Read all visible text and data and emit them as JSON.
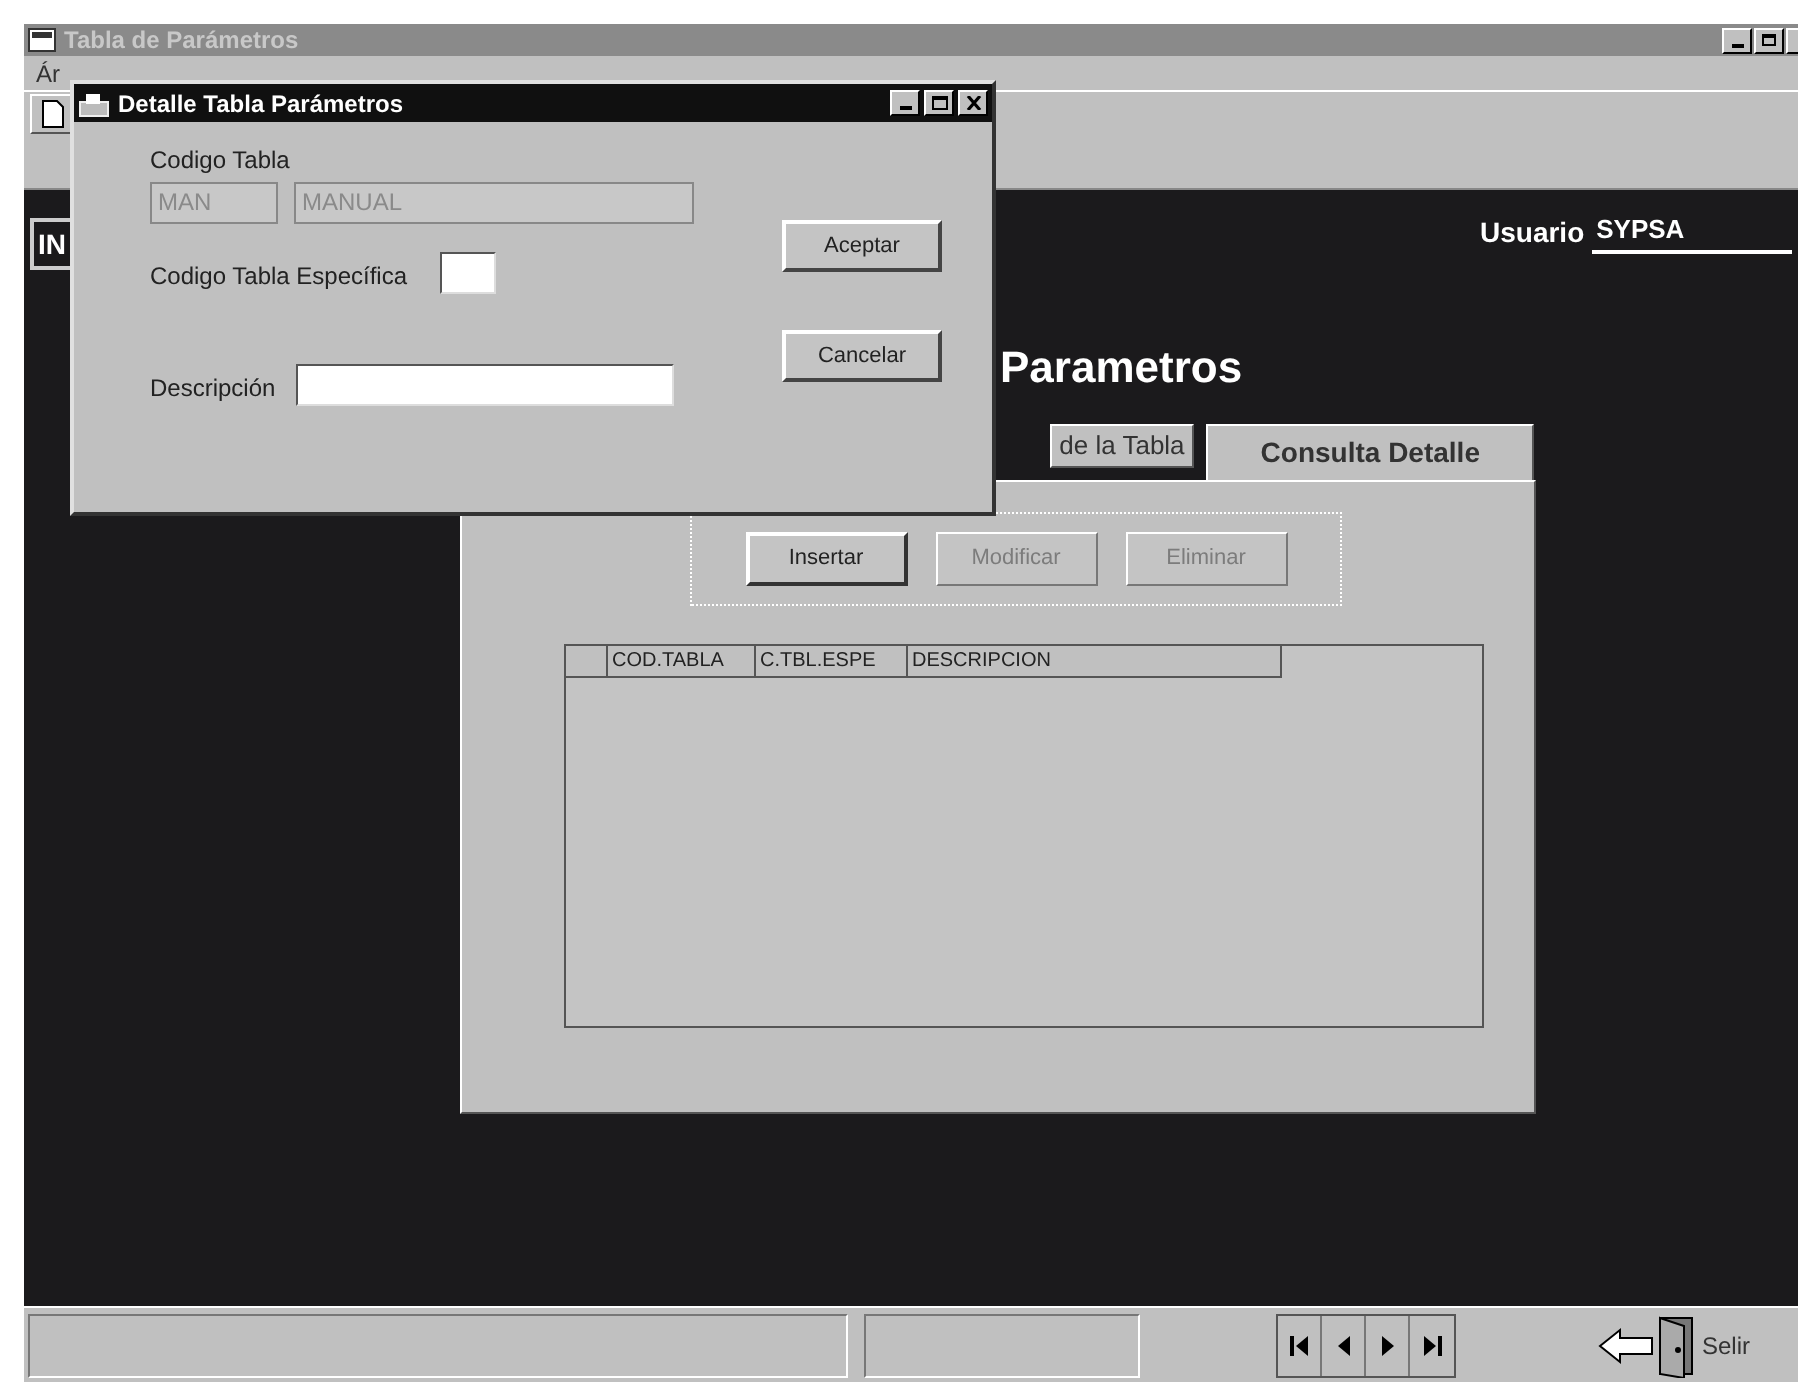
{
  "main_window": {
    "title": "Tabla de Parámetros"
  },
  "menu": [
    {
      "label": "Ár"
    }
  ],
  "header": {
    "badge": "IN",
    "title": "Parametros",
    "user_label": "Usuario",
    "user_value": "SYPSA"
  },
  "tabs": [
    {
      "label": "de la Tabla",
      "selected": false
    },
    {
      "label": "Consulta Detalle",
      "selected": true
    }
  ],
  "actions": [
    {
      "label": "Insertar",
      "disabled": false
    },
    {
      "label": "Modificar",
      "disabled": true
    },
    {
      "label": "Eliminar",
      "disabled": true
    }
  ],
  "grid": {
    "columns": [
      "COD.TABLA",
      "C.TBL.ESPE",
      "DESCRIPCION"
    ]
  },
  "status_bar": {
    "exit_label": "Selir"
  },
  "dialog": {
    "title": "Detalle Tabla Parámetros",
    "codigo_tabla": {
      "label": "Codigo Tabla",
      "code": "MAN",
      "name": "MANUAL",
      "disabled": true
    },
    "especifica": {
      "label": "Codigo Tabla Específica",
      "disabled": false
    },
    "descripcion": {
      "label": "Descripción",
      "disabled": false
    },
    "buttons": [
      {
        "label": "Aceptar"
      },
      {
        "label": "Cancelar"
      }
    ]
  }
}
